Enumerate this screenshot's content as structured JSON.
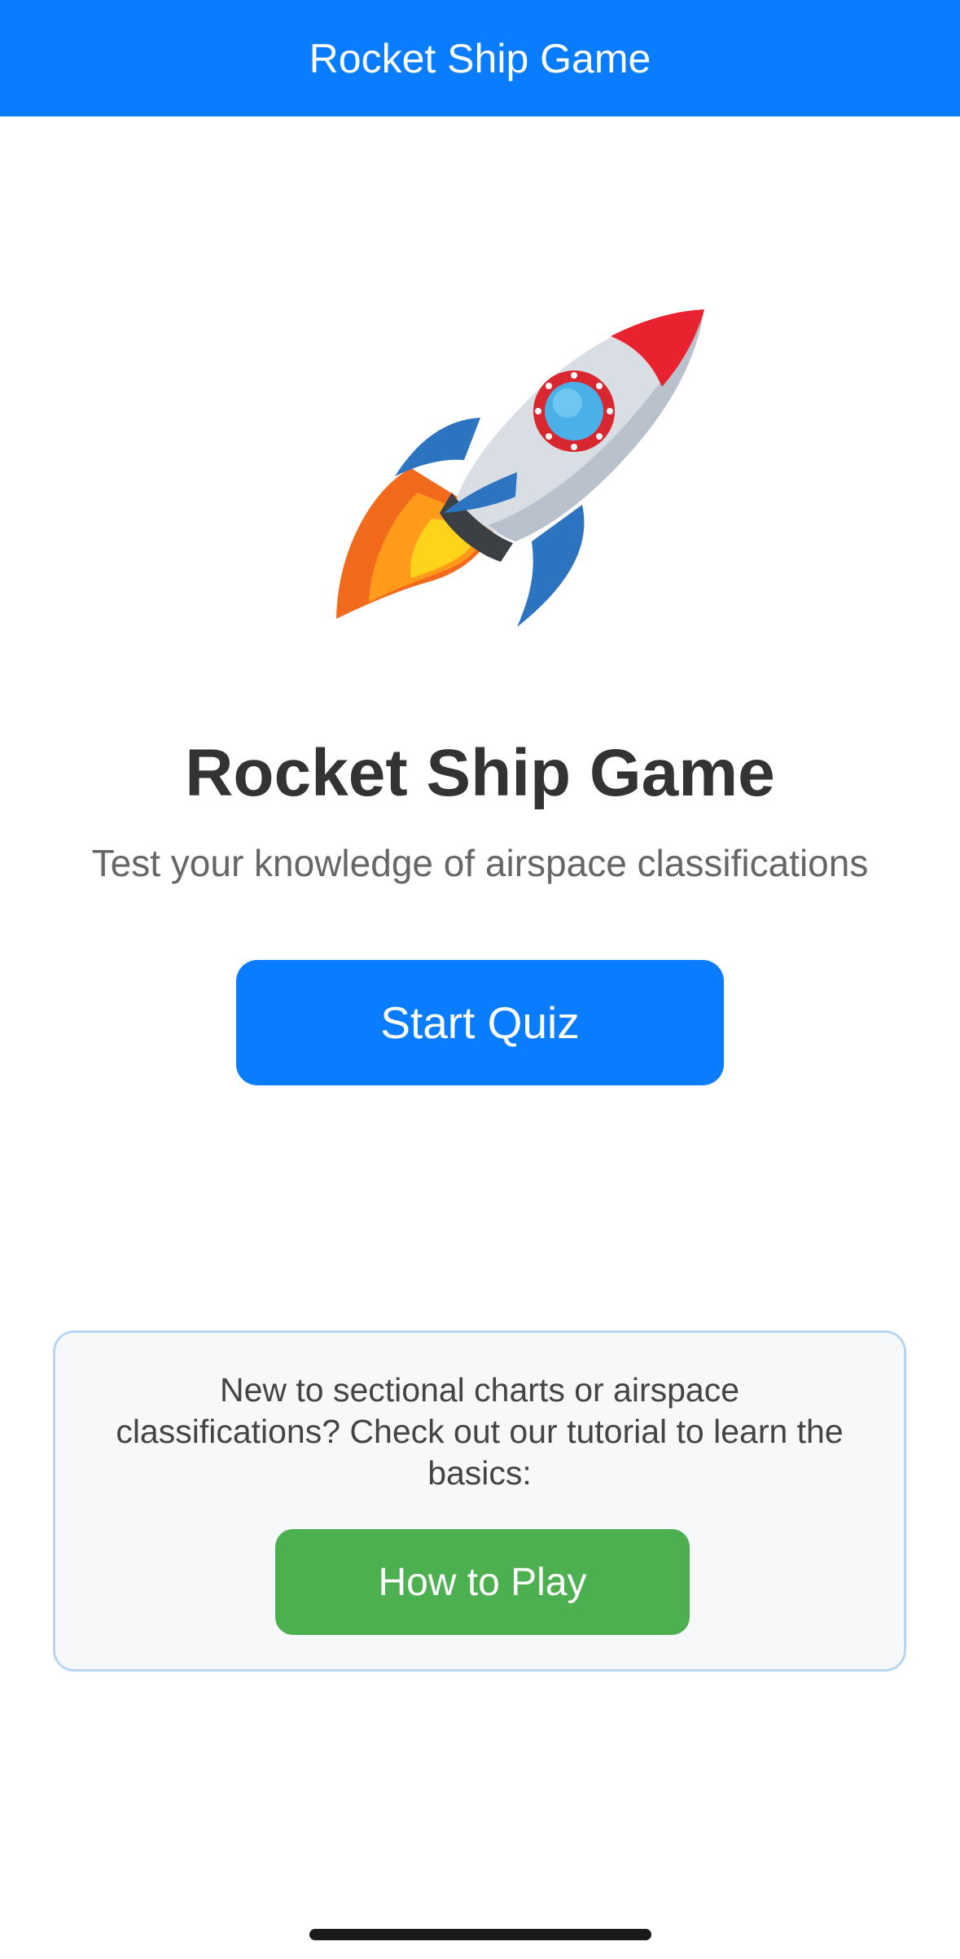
{
  "nav": {
    "title": "Rocket Ship Game"
  },
  "hero": {
    "icon": "rocket-icon",
    "title": "Rocket Ship Game",
    "subtitle": "Test your knowledge of airspace classifications",
    "start_label": "Start Quiz"
  },
  "tutorial": {
    "text": "New to sectional charts or airspace classifications? Check out our tutorial to learn the basics:",
    "button_label": "How to Play"
  },
  "colors": {
    "primary": "#0a7cff",
    "tutorial_button": "#4caf50",
    "card_background": "#f6f8fa",
    "card_border": "#b6d6f7",
    "title_text": "#333333",
    "subtitle_text": "#666666"
  }
}
